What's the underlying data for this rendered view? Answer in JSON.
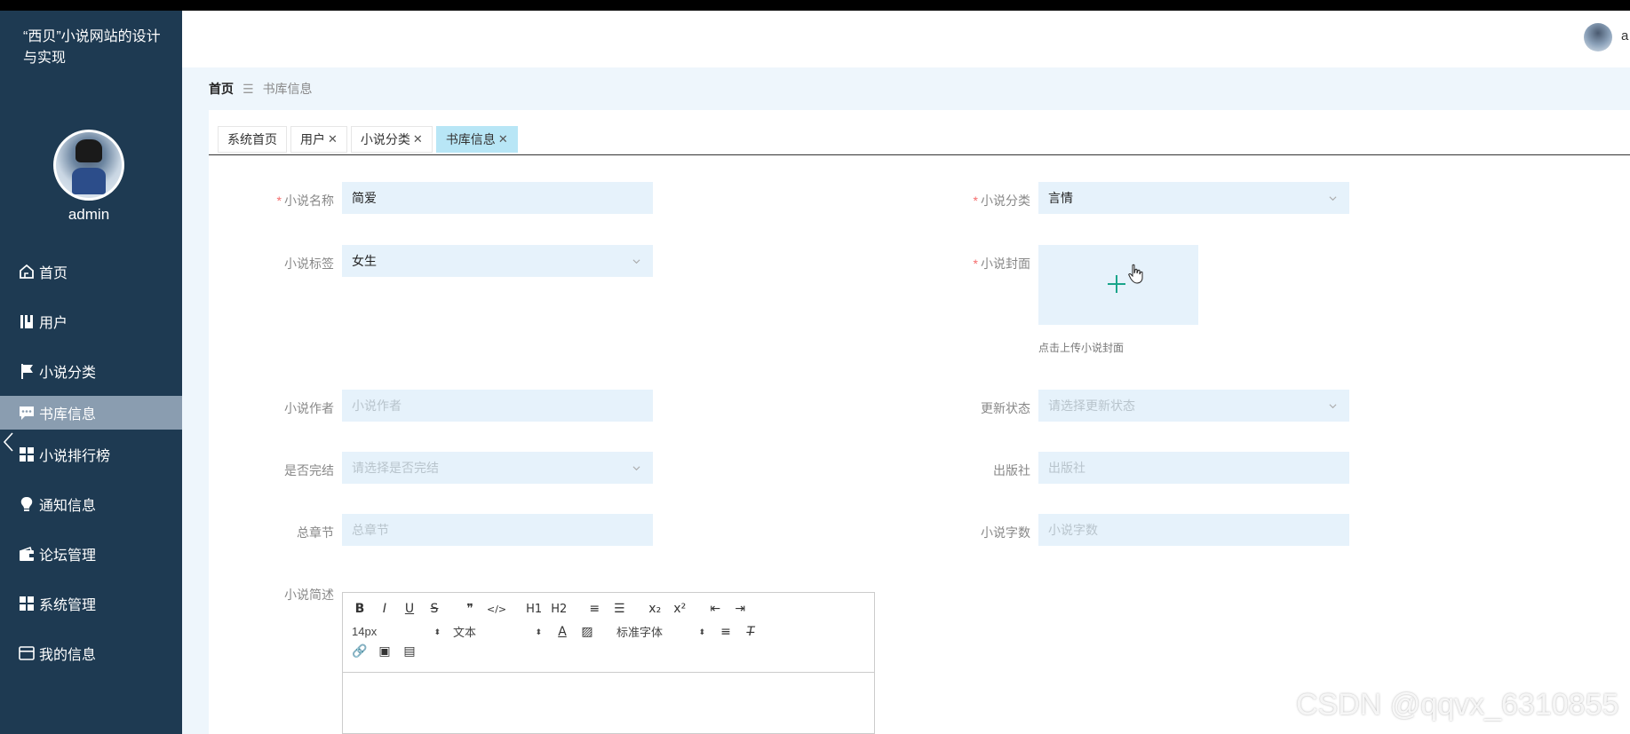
{
  "app": {
    "title": "“西贝”小说网站的设计与实现"
  },
  "user": {
    "name": "admin",
    "header_name": "a"
  },
  "sidebar": {
    "items": [
      {
        "label": "首页",
        "icon": "home-icon"
      },
      {
        "label": "用户",
        "icon": "book-icon"
      },
      {
        "label": "小说分类",
        "icon": "flag-icon"
      },
      {
        "label": "书库信息",
        "icon": "chat-icon",
        "active": true
      },
      {
        "label": "小说排行榜",
        "icon": "grid-icon"
      },
      {
        "label": "通知信息",
        "icon": "bulb-icon"
      },
      {
        "label": "论坛管理",
        "icon": "wallet-icon"
      },
      {
        "label": "系统管理",
        "icon": "grid-icon"
      },
      {
        "label": "我的信息",
        "icon": "card-icon"
      }
    ]
  },
  "breadcrumb": {
    "home": "首页",
    "separator": "☰",
    "current": "书库信息"
  },
  "tabs": [
    {
      "label": "系统首页",
      "closable": false
    },
    {
      "label": "用户",
      "closable": true
    },
    {
      "label": "小说分类",
      "closable": true
    },
    {
      "label": "书库信息",
      "closable": true,
      "active": true
    }
  ],
  "form": {
    "name": {
      "label": "小说名称",
      "required": true,
      "value": "简爱"
    },
    "category": {
      "label": "小说分类",
      "required": true,
      "value": "言情"
    },
    "tag": {
      "label": "小说标签",
      "required": false,
      "value": "女生"
    },
    "cover": {
      "label": "小说封面",
      "required": true,
      "hint": "点击上传小说封面"
    },
    "author": {
      "label": "小说作者",
      "placeholder": "小说作者"
    },
    "update_status": {
      "label": "更新状态",
      "placeholder": "请选择更新状态"
    },
    "finished": {
      "label": "是否完结",
      "placeholder": "请选择是否完结"
    },
    "publisher": {
      "label": "出版社",
      "placeholder": "出版社"
    },
    "chapters": {
      "label": "总章节",
      "placeholder": "总章节"
    },
    "word_count": {
      "label": "小说字数",
      "placeholder": "小说字数"
    },
    "description": {
      "label": "小说简述"
    }
  },
  "editor": {
    "row1": [
      "B",
      "I",
      "U",
      "S",
      "❞",
      "</>",
      "H1",
      "H2",
      "≡",
      "☰",
      "x₂",
      "x²",
      "⇤",
      "⇥"
    ],
    "font_size": "14px",
    "text_style": "文本",
    "font_family": "标准字体"
  },
  "watermark": "CSDN @qqvx_6310855",
  "colors": {
    "sidebar": "#1e3a52",
    "active_item": "#8a9db0",
    "field_bg": "#e6f2fb",
    "active_tab": "#b8e6f6",
    "required": "#f56c6c",
    "upload_plus": "#1aa58a"
  }
}
